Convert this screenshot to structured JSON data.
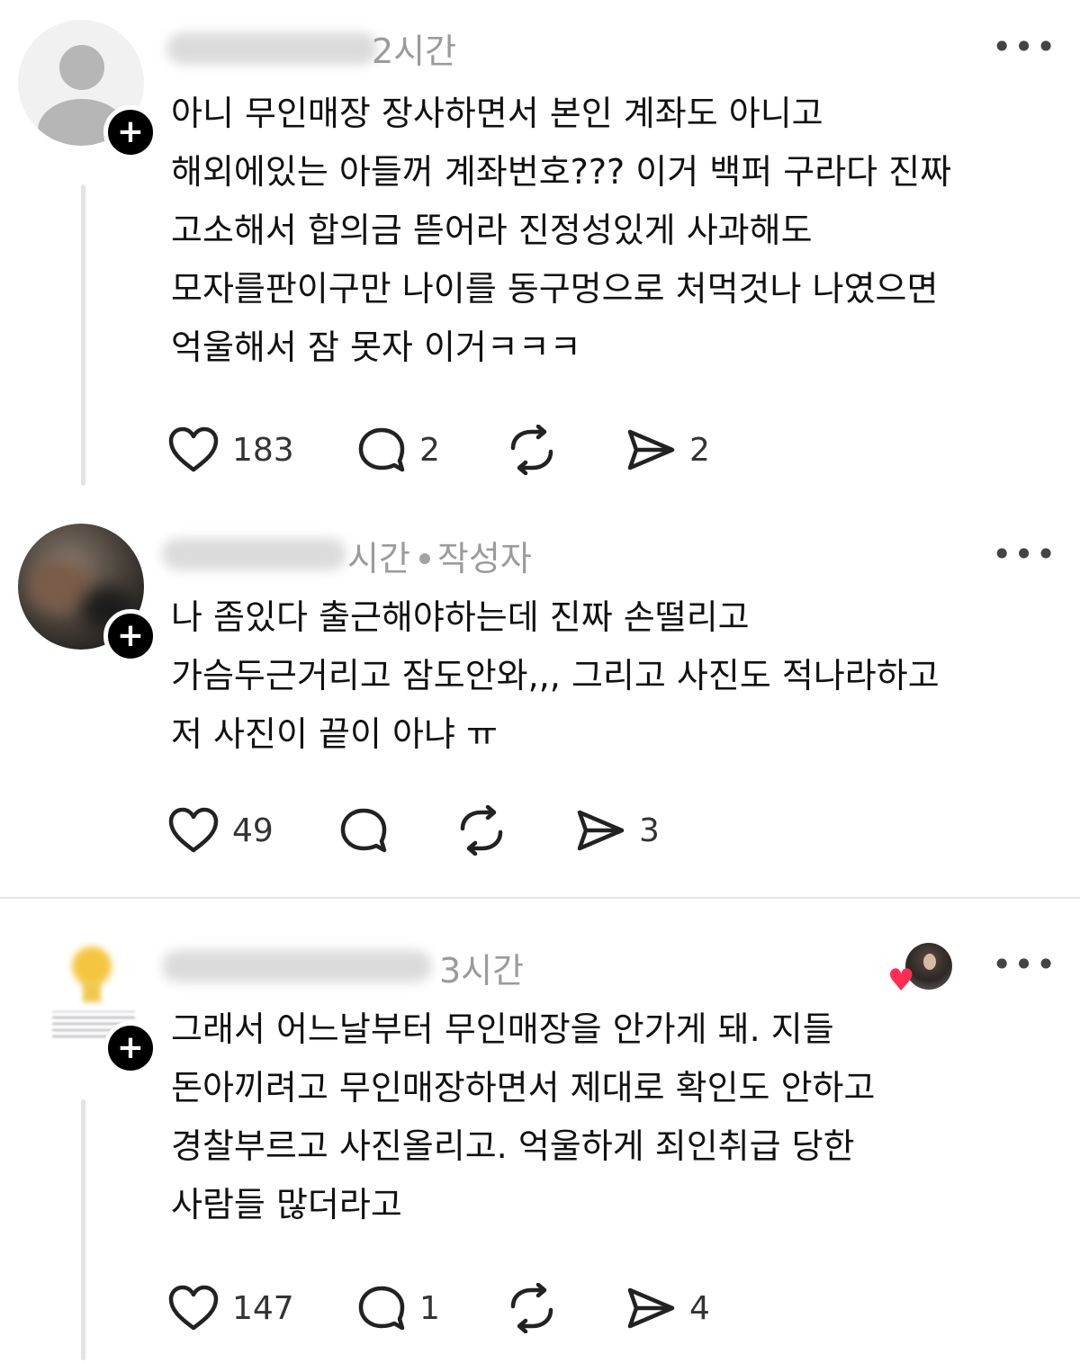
{
  "posts": [
    {
      "time": "2시간",
      "lines": [
        "아니 무인매장 장사하면서 본인 계좌도 아니고",
        "해외에있는 아들꺼 계좌번호??? 이거 백퍼 구라다 진짜",
        "고소해서 합의금 뜯어라 진정성있게 사과해도",
        "모자를판이구만 나이를 동구멍으로 처먹것나 나였으면",
        "억울해서 잠 못자 이거ㅋㅋㅋ"
      ],
      "likes": "183",
      "replies": "2",
      "reposts": "",
      "shares": "2"
    },
    {
      "time": "시간",
      "author_tag": "작성자",
      "lines": [
        "나 좀있다 출근해야하는데 진짜 손떨리고",
        "가슴두근거리고 잠도안와,,, 그리고 사진도 적나라하고",
        "저 사진이 끝이 아냐 ㅠ"
      ],
      "likes": "49",
      "replies": "",
      "reposts": "",
      "shares": "3"
    },
    {
      "time": "3시간",
      "lines": [
        "그래서 어느날부터 무인매장을 안가게 돼. 지들",
        "돈아끼려고 무인매장하면서 제대로 확인도 안하고",
        "경찰부르고 사진올리고. 억울하게 죄인취급 당한",
        "사람들 많더라고"
      ],
      "likes": "147",
      "replies": "1",
      "reposts": "",
      "shares": "4"
    }
  ],
  "ui": {
    "more": "•••",
    "plus": "+",
    "heart": "♥"
  },
  "icons": [
    "heart-icon",
    "comment-icon",
    "repost-icon",
    "share-icon",
    "more-icon",
    "follow-plus-icon"
  ],
  "colors": {
    "text": "#111111",
    "meta": "#9b9b9b",
    "badge": "#000000",
    "like_heart": "#ff2d55",
    "divider": "#e6e6e6"
  }
}
